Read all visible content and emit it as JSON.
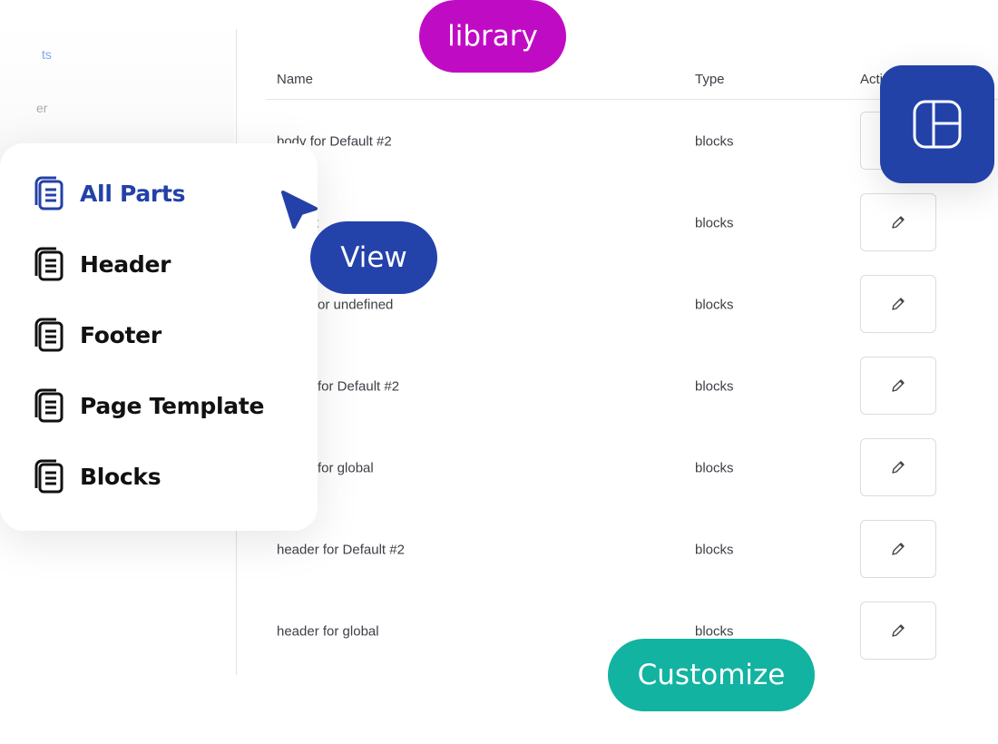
{
  "sidebar_faded": {
    "fragment_1": "ts",
    "fragment_2": "er"
  },
  "table": {
    "headers": {
      "name": "Name",
      "type": "Type",
      "actions": "Acti"
    },
    "rows": [
      {
        "name": "body for Default #2",
        "type": "blocks"
      },
      {
        "name": "or post",
        "type": "blocks"
      },
      {
        "name": "or undefined",
        "type": "blocks"
      },
      {
        "name": "for Default #2",
        "type": "blocks"
      },
      {
        "name": "for global",
        "type": "blocks"
      },
      {
        "name": "header for Default #2",
        "type": "blocks"
      },
      {
        "name": "header for global",
        "type": "blocks"
      }
    ],
    "action_icon": "pencil-icon"
  },
  "menu": {
    "items": [
      {
        "label": "All Parts",
        "active": true
      },
      {
        "label": "Header",
        "active": false
      },
      {
        "label": "Footer",
        "active": false
      },
      {
        "label": "Page Template",
        "active": false
      },
      {
        "label": "Blocks",
        "active": false
      }
    ],
    "icon": "documents-icon"
  },
  "badges": {
    "library": "library",
    "view": "View",
    "customize": "Customize"
  },
  "colors": {
    "accent": "#2341a8",
    "library": "#c00bc4",
    "customize": "#12b3a0"
  }
}
